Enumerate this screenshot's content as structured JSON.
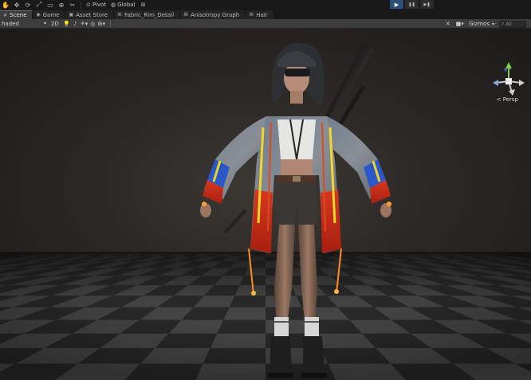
{
  "toolbar": {
    "tools": [
      {
        "name": "hand-tool-icon",
        "glyph": "✋"
      },
      {
        "name": "move-tool-icon",
        "glyph": "✥"
      },
      {
        "name": "rotate-tool-icon",
        "glyph": "⟳"
      },
      {
        "name": "scale-tool-icon",
        "glyph": "⤢"
      },
      {
        "name": "rect-tool-icon",
        "glyph": "▭"
      },
      {
        "name": "transform-tool-icon",
        "glyph": "⊕"
      },
      {
        "name": "custom-tool-icon",
        "glyph": "✂"
      }
    ],
    "pivot_label": "Pivot",
    "global_label": "Global",
    "play_icon": "▶",
    "pause_icon": "❚❚",
    "step_icon": "▶❚"
  },
  "tabs": [
    {
      "label": "Scene",
      "icon": "#",
      "active": true
    },
    {
      "label": "Game",
      "icon": "◉",
      "active": false
    },
    {
      "label": "Asset Store",
      "icon": "▣",
      "active": false
    },
    {
      "label": "Fabric_Rim_Detail",
      "icon": "⌘",
      "active": false
    },
    {
      "label": "Anisotropy Graph",
      "icon": "⌘",
      "active": false
    },
    {
      "label": "Hair",
      "icon": "⌘",
      "active": false
    }
  ],
  "scene_toolbar": {
    "draw_mode": "haded",
    "mode_2d": "2D",
    "gizmos_label": "Gizmos",
    "search_placeholder": "All"
  },
  "viewport": {
    "projection_label": "< Persp"
  },
  "colors": {
    "accent": "#2b4f77",
    "background": "#191919",
    "panel": "#3c3c3c"
  }
}
